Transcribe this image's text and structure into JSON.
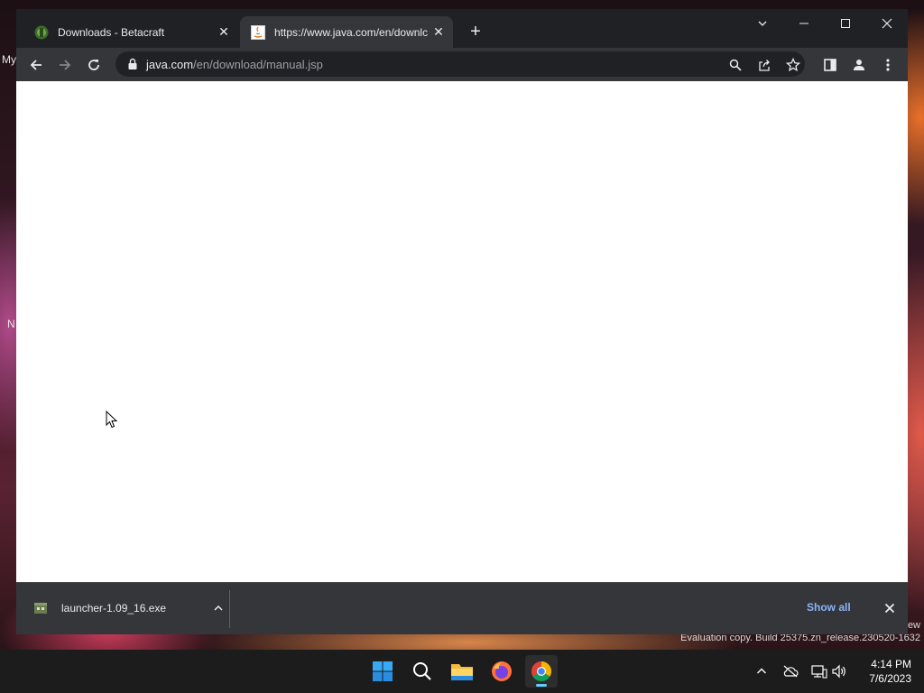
{
  "desktop": {
    "label_top": "My",
    "label_mid": "N",
    "watermark_line1": "ew",
    "watermark_line2": "Evaluation copy. Build 25375.zn_release.230520-1632"
  },
  "browser": {
    "tabs": [
      {
        "title": "Downloads - Betacraft",
        "icon": "betacraft-favicon",
        "active": false
      },
      {
        "title": "https://www.java.com/en/downlc",
        "icon": "java-favicon",
        "active": true
      }
    ],
    "new_tab_label": "+",
    "address": {
      "host": "java.com",
      "path": "/en/download/manual.jsp"
    },
    "colors": {
      "frame": "#202124",
      "toolbar": "#35363a",
      "accent_link": "#8ab4f8"
    }
  },
  "download_bar": {
    "file_name": "launcher-1.09_16.exe",
    "show_all_label": "Show all"
  },
  "taskbar": {
    "apps": [
      "start-icon",
      "search-icon",
      "file-explorer-icon",
      "firefox-icon",
      "chrome-icon"
    ],
    "active_app": "chrome-icon",
    "time": "4:14 PM",
    "date": "7/6/2023"
  }
}
